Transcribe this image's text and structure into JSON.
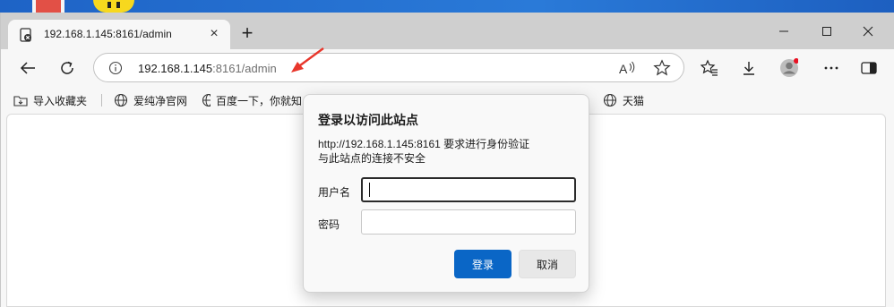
{
  "browser": {
    "tab": {
      "title": "192.168.1.145:8161/admin"
    },
    "address": {
      "host": "192.168.1.145",
      "path": ":8161/admin"
    },
    "bookmarks": [
      {
        "label": "导入收藏夹",
        "icon": "import-favorites-icon"
      },
      {
        "label": "爱纯净官网",
        "icon": "globe-icon"
      },
      {
        "label": "百度一下，你就知",
        "icon": "globe-icon"
      },
      {
        "label": "天猫",
        "icon": "globe-icon"
      }
    ]
  },
  "dialog": {
    "title": "登录以访问此站点",
    "message_line1": "http://192.168.1.145:8161 要求进行身份验证",
    "message_line2": "与此站点的连接不安全",
    "username_label": "用户名",
    "password_label": "密码",
    "username_value": "",
    "password_value": "",
    "login_button": "登录",
    "cancel_button": "取消"
  },
  "colors": {
    "accent": "#0a66c6",
    "annotation_arrow": "#e8362b",
    "desktop": "#1f6fd0"
  }
}
